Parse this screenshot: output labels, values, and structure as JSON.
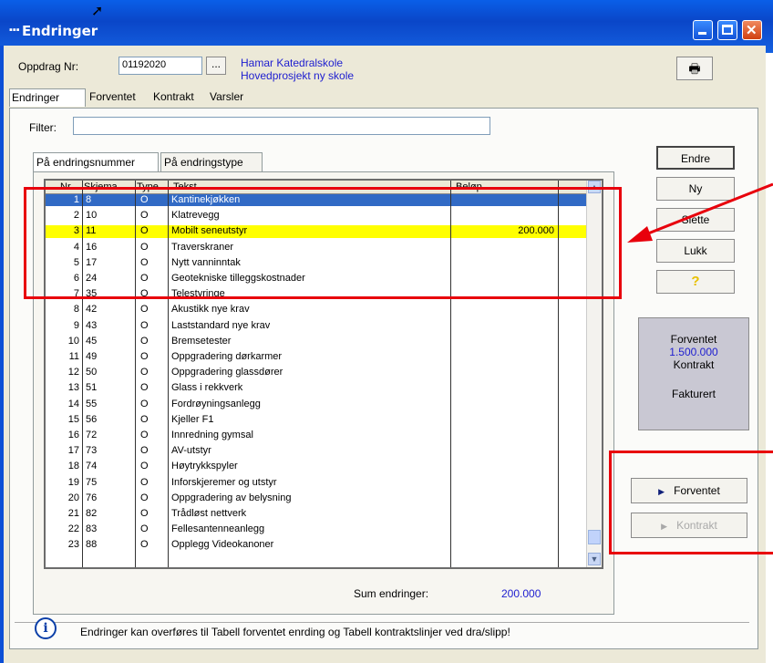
{
  "window": {
    "title": "Endringer"
  },
  "header": {
    "oppdrag_label": "Oppdrag Nr:",
    "oppdrag_value": "01192020",
    "browse_label": "...",
    "project_name": "Hamar Katedralskole",
    "project_sub": "Hovedprosjekt ny skole"
  },
  "tabs": [
    "Endringer",
    "Forventet",
    "Kontrakt",
    "Varsler"
  ],
  "filter": {
    "label": "Filter:",
    "value": ""
  },
  "subtabs": [
    "På endringsnummer",
    "På endringstype"
  ],
  "grid": {
    "columns": [
      "Nr.",
      "Skjema",
      "Type",
      "Tekst",
      "Beløp"
    ],
    "rows": [
      {
        "nr": "1",
        "skjema": "8",
        "type": "O",
        "tekst": "Kantinekjøkken",
        "belop": ""
      },
      {
        "nr": "2",
        "skjema": "10",
        "type": "O",
        "tekst": "Klatrevegg",
        "belop": ""
      },
      {
        "nr": "3",
        "skjema": "11",
        "type": "O",
        "tekst": "Mobilt seneutstyr",
        "belop": "200.000"
      },
      {
        "nr": "4",
        "skjema": "16",
        "type": "O",
        "tekst": "Traverskraner",
        "belop": ""
      },
      {
        "nr": "5",
        "skjema": "17",
        "type": "O",
        "tekst": "Nytt vanninntak",
        "belop": ""
      },
      {
        "nr": "6",
        "skjema": "24",
        "type": "O",
        "tekst": "Geotekniske tilleggskostnader",
        "belop": ""
      },
      {
        "nr": "7",
        "skjema": "35",
        "type": "O",
        "tekst": "Telestyringe",
        "belop": ""
      },
      {
        "nr": "8",
        "skjema": "42",
        "type": "O",
        "tekst": "Akustikk nye krav",
        "belop": ""
      },
      {
        "nr": "9",
        "skjema": "43",
        "type": "O",
        "tekst": "Laststandard nye krav",
        "belop": ""
      },
      {
        "nr": "10",
        "skjema": "45",
        "type": "O",
        "tekst": "Bremsetester",
        "belop": ""
      },
      {
        "nr": "11",
        "skjema": "49",
        "type": "O",
        "tekst": "Oppgradering dørkarmer",
        "belop": ""
      },
      {
        "nr": "12",
        "skjema": "50",
        "type": "O",
        "tekst": "Oppgradering glassdører",
        "belop": ""
      },
      {
        "nr": "13",
        "skjema": "51",
        "type": "O",
        "tekst": "Glass i rekkverk",
        "belop": ""
      },
      {
        "nr": "14",
        "skjema": "55",
        "type": "O",
        "tekst": "Fordrøyningsanlegg",
        "belop": ""
      },
      {
        "nr": "15",
        "skjema": "56",
        "type": "O",
        "tekst": "Kjeller F1",
        "belop": ""
      },
      {
        "nr": "16",
        "skjema": "72",
        "type": "O",
        "tekst": "Innredning gymsal",
        "belop": ""
      },
      {
        "nr": "17",
        "skjema": "73",
        "type": "O",
        "tekst": "AV-utstyr",
        "belop": ""
      },
      {
        "nr": "18",
        "skjema": "74",
        "type": "O",
        "tekst": "Høytrykkspyler",
        "belop": ""
      },
      {
        "nr": "19",
        "skjema": "75",
        "type": "O",
        "tekst": "Inforskjeremer og utstyr",
        "belop": ""
      },
      {
        "nr": "20",
        "skjema": "76",
        "type": "O",
        "tekst": "Oppgradering av belysning",
        "belop": ""
      },
      {
        "nr": "21",
        "skjema": "82",
        "type": "O",
        "tekst": "Trådløst nettverk",
        "belop": ""
      },
      {
        "nr": "22",
        "skjema": "83",
        "type": "O",
        "tekst": "Fellesantenneanlegg",
        "belop": ""
      },
      {
        "nr": "23",
        "skjema": "88",
        "type": "O",
        "tekst": "Opplegg Videokanoner",
        "belop": ""
      }
    ]
  },
  "sum": {
    "label": "Sum endringer:",
    "value": "200.000"
  },
  "buttons": {
    "endre": "Endre",
    "ny": "Ny",
    "slette": "Slette",
    "lukk": "Lukk",
    "help": "?",
    "forventet": "Forventet",
    "kontrakt": "Kontrakt"
  },
  "info": {
    "forventet_label": "Forventet",
    "forventet_value": "1.500.000",
    "kontrakt_label": "Kontrakt",
    "fakturert_label": "Fakturert"
  },
  "footer": {
    "message": "Endringer kan overføres til Tabell forventet enrding og Tabell kontraktslinjer ved dra/slipp!"
  },
  "colors": {
    "selected_row": "#316ac5",
    "highlight_row": "#ffff00",
    "annotation": "#e8000c",
    "link_blue": "#2020d0"
  }
}
